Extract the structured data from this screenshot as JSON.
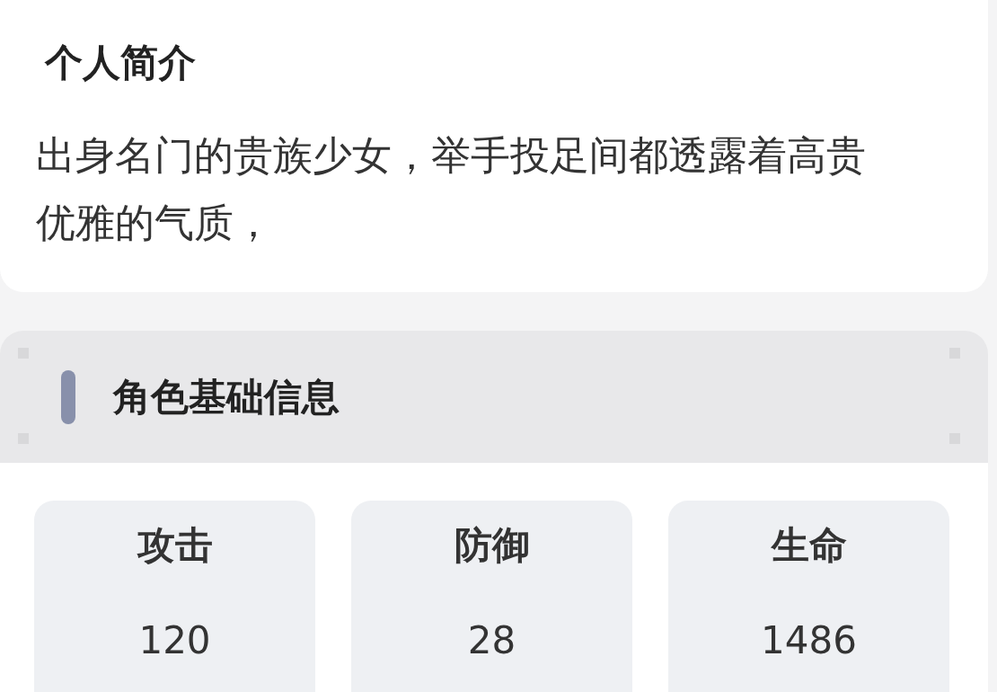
{
  "intro": {
    "title": "个人简介",
    "text": "出身名门的贵族少女，举手投足间都透露着高贵优雅的气质，"
  },
  "basic_info": {
    "title": "角色基础信息",
    "stats": [
      {
        "label": "攻击",
        "value": "120"
      },
      {
        "label": "防御",
        "value": "28"
      },
      {
        "label": "生命",
        "value": "1486"
      }
    ]
  }
}
